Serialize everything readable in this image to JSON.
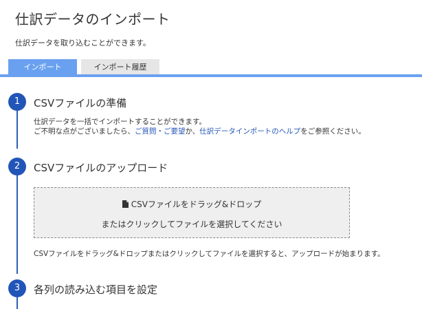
{
  "header": {
    "title": "仕訳データのインポート",
    "subtitle": "仕訳データを取り込むことができます。"
  },
  "tabs": [
    {
      "label": "インポート",
      "active": true
    },
    {
      "label": "インポート履歴",
      "active": false
    }
  ],
  "steps": [
    {
      "number": "1",
      "title": "CSVファイルの準備",
      "desc_line1": "仕訳データを一括でインポートすることができます。",
      "desc_line2_prefix": "ご不明な点がございましたら、",
      "link_support": "ご質問・ご要望",
      "desc_line2_mid": "か、",
      "link_help": "仕訳データインポートのヘルプ",
      "desc_line2_suffix": "をご参照ください。"
    },
    {
      "number": "2",
      "title": "CSVファイルのアップロード",
      "dropzone_line1": "CSVファイルをドラッグ&ドロップ",
      "dropzone_line2": "またはクリックしてファイルを選択してください",
      "note": "CSVファイルをドラッグ&ドロップまたはクリックしてファイルを選択すると、アップロードが始まります。"
    },
    {
      "number": "3",
      "title": "各列の読み込む項目を設定"
    }
  ],
  "colors": {
    "accent": "#6aa0f0",
    "step_circle": "#2255b8",
    "link": "#2255b8"
  },
  "icons": {
    "dropzone": "file-icon"
  }
}
